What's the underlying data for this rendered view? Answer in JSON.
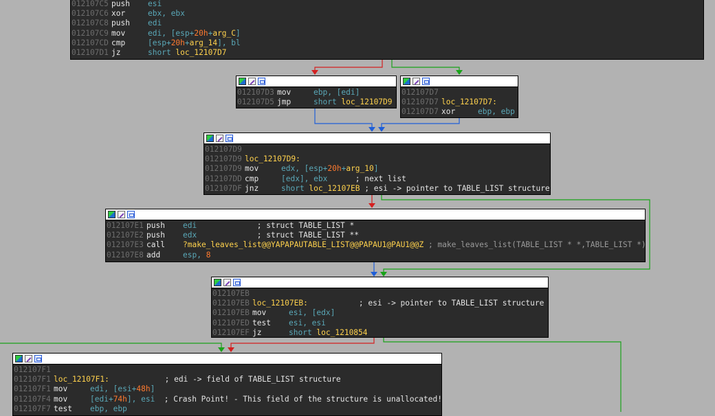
{
  "colors": {
    "background": "#b2b2b2",
    "node_bg": "#2b2b2b",
    "address": "#6d6d6d",
    "operand": "#5aa8b8",
    "label": "#ffd24d",
    "number": "#ff7a2f",
    "edge_true": "#1aa31a",
    "edge_false": "#d42020",
    "edge_uncond": "#1f5fd8"
  },
  "header_icons": [
    "color-palette-icon",
    "edit-pencil-icon",
    "graph-view-icon"
  ],
  "nodes": {
    "n1": {
      "lines": [
        {
          "addr": "012107C5",
          "mn": "push",
          "ops": [
            [
              "op",
              "esi"
            ]
          ]
        },
        {
          "addr": "012107C6",
          "mn": "xor",
          "ops": [
            [
              "op",
              "ebx, ebx"
            ]
          ]
        },
        {
          "addr": "012107C8",
          "mn": "push",
          "ops": [
            [
              "op",
              "edi"
            ]
          ]
        },
        {
          "addr": "012107C9",
          "mn": "mov",
          "ops": [
            [
              "op",
              "edi, [esp+"
            ],
            [
              "num",
              "20h"
            ],
            [
              "op",
              "+"
            ],
            [
              "lbl",
              "arg_C"
            ],
            [
              "op",
              "]"
            ]
          ]
        },
        {
          "addr": "012107CD",
          "mn": "cmp",
          "ops": [
            [
              "op",
              "[esp+"
            ],
            [
              "num",
              "20h"
            ],
            [
              "op",
              "+"
            ],
            [
              "lbl",
              "arg_14"
            ],
            [
              "op",
              "], bl"
            ]
          ]
        },
        {
          "addr": "012107D1",
          "mn": "jz",
          "ops": [
            [
              "op",
              "short "
            ],
            [
              "lbl",
              "loc_12107D7"
            ]
          ]
        }
      ]
    },
    "n2": {
      "lines": [
        {
          "addr": "012107D3",
          "mn": "mov",
          "ops": [
            [
              "op",
              "ebp, [edi]"
            ]
          ]
        },
        {
          "addr": "012107D5",
          "mn": "jmp",
          "ops": [
            [
              "op",
              "short "
            ],
            [
              "lbl",
              "loc_12107D9"
            ]
          ]
        }
      ]
    },
    "n3": {
      "lines": [
        {
          "addr": "012107D7",
          "mn": "",
          "ops": []
        },
        {
          "addr": "012107D7",
          "mn": "",
          "ops": [
            [
              "lbl",
              "loc_12107D7:"
            ]
          ]
        },
        {
          "addr": "012107D7",
          "mn": "xor",
          "ops": [
            [
              "op",
              "ebp, ebp"
            ]
          ]
        }
      ]
    },
    "n4": {
      "lines": [
        {
          "addr": "012107D9",
          "mn": "",
          "ops": []
        },
        {
          "addr": "012107D9",
          "mn": "",
          "ops": [
            [
              "lbl",
              "loc_12107D9:"
            ]
          ]
        },
        {
          "addr": "012107D9",
          "mn": "mov",
          "ops": [
            [
              "op",
              "edx, [esp+"
            ],
            [
              "num",
              "20h"
            ],
            [
              "op",
              "+"
            ],
            [
              "lbl",
              "arg_10"
            ],
            [
              "op",
              "]"
            ]
          ]
        },
        {
          "addr": "012107DD",
          "mn": "cmp",
          "ops": [
            [
              "op",
              "[edx], ebx"
            ],
            [
              "cmt",
              "      ; next list"
            ]
          ]
        },
        {
          "addr": "012107DF",
          "mn": "jnz",
          "ops": [
            [
              "op",
              "short "
            ],
            [
              "lbl",
              "loc_12107EB"
            ],
            [
              "cmt",
              " ; esi -> pointer to TABLE_LIST structure"
            ]
          ]
        }
      ]
    },
    "n5": {
      "lines": [
        {
          "addr": "012107E1",
          "mn": "push",
          "ops": [
            [
              "op",
              "edi"
            ],
            [
              "cmt",
              "             ; struct TABLE_LIST *"
            ]
          ]
        },
        {
          "addr": "012107E2",
          "mn": "push",
          "ops": [
            [
              "op",
              "edx"
            ],
            [
              "cmt",
              "             ; struct TABLE_LIST **"
            ]
          ]
        },
        {
          "addr": "012107E3",
          "mn": "call",
          "ops": [
            [
              "lbl",
              "?make_leaves_list@@YAPAPAUTABLE_LIST@@PAPAU1@PAU1@@Z"
            ],
            [
              "cmtg",
              " ; make_leaves_list(TABLE_LIST * *,TABLE_LIST *)"
            ]
          ]
        },
        {
          "addr": "012107E8",
          "mn": "add",
          "ops": [
            [
              "op",
              "esp, "
            ],
            [
              "num",
              "8"
            ]
          ]
        }
      ]
    },
    "n6": {
      "lines": [
        {
          "addr": "012107EB",
          "mn": "",
          "ops": []
        },
        {
          "addr": "012107EB",
          "mn": "",
          "ops": [
            [
              "lbl",
              "loc_12107EB:"
            ],
            [
              "cmt",
              "           ; esi -> pointer to TABLE_LIST structure"
            ]
          ]
        },
        {
          "addr": "012107EB",
          "mn": "mov",
          "ops": [
            [
              "op",
              "esi, [edx]"
            ]
          ]
        },
        {
          "addr": "012107ED",
          "mn": "test",
          "ops": [
            [
              "op",
              "esi, esi"
            ]
          ]
        },
        {
          "addr": "012107EF",
          "mn": "jz",
          "ops": [
            [
              "op",
              "short "
            ],
            [
              "lbl",
              "loc_1210854"
            ]
          ]
        }
      ]
    },
    "n7": {
      "lines": [
        {
          "addr": "012107F1",
          "mn": "",
          "ops": []
        },
        {
          "addr": "012107F1",
          "mn": "",
          "ops": [
            [
              "lbl",
              "loc_12107F1:"
            ],
            [
              "cmt",
              "            ; edi -> field of TABLE_LIST structure"
            ]
          ]
        },
        {
          "addr": "012107F1",
          "mn": "mov",
          "ops": [
            [
              "op",
              "edi, [esi+"
            ],
            [
              "num",
              "48h"
            ],
            [
              "op",
              "]"
            ]
          ]
        },
        {
          "addr": "012107F4",
          "mn": "mov",
          "ops": [
            [
              "op",
              "[edi+"
            ],
            [
              "num",
              "74h"
            ],
            [
              "op",
              "], esi"
            ],
            [
              "cmt",
              "  ; Crash Point! - This field of the structure is unallocated!"
            ]
          ]
        },
        {
          "addr": "012107F7",
          "mn": "test",
          "ops": [
            [
              "op",
              "ebp, ebp"
            ]
          ]
        }
      ]
    }
  }
}
